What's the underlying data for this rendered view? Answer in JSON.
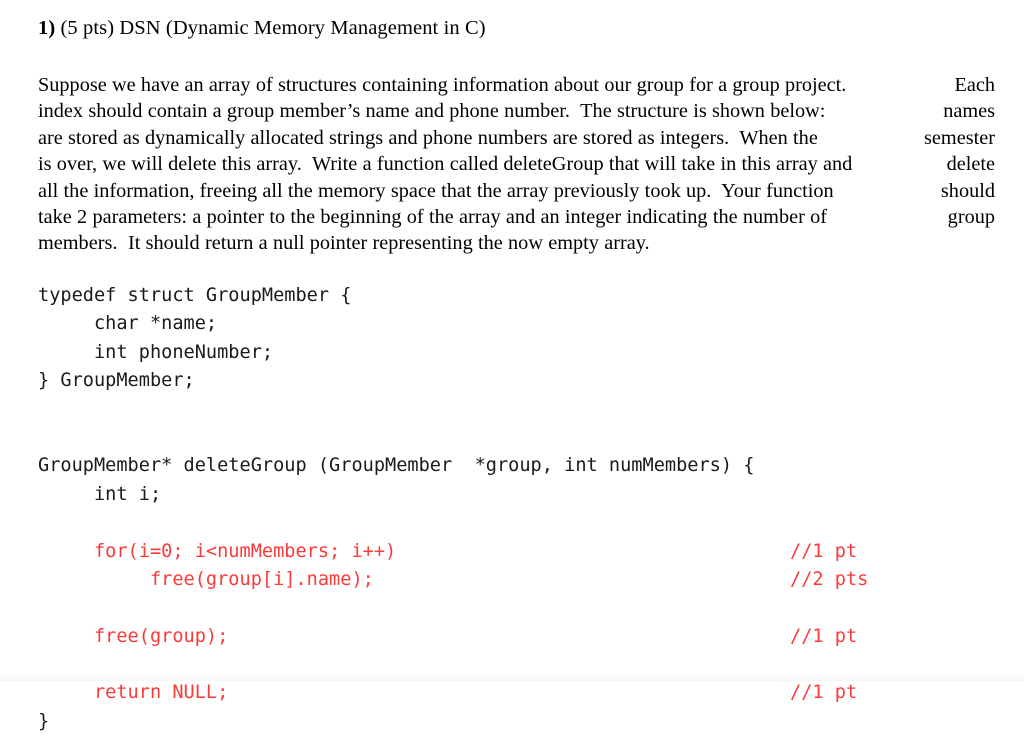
{
  "document": {
    "heading": {
      "number": "1)",
      "rest": " (5 pts) DSN (Dynamic Memory Management in C)"
    },
    "paragraph": {
      "lines": [
        {
          "left": "Suppose we have an array of structures containing information about our group for a group project.",
          "right": "Each"
        },
        {
          "left": "index should contain a group member’s name and phone number.  The structure is shown below:",
          "right": "names"
        },
        {
          "left": "are stored as dynamically allocated strings and phone numbers are stored as integers.  When the",
          "right": "semester"
        },
        {
          "left": "is over, we will delete this array.  Write a function called deleteGroup that will take in this array and",
          "right": "delete"
        },
        {
          "left": "all the information, freeing all the memory space that the array previously took up.  Your function",
          "right": "should"
        },
        {
          "left": "take 2 parameters: a pointer to the beginning of the array and an integer indicating the number of",
          "right": "group"
        },
        {
          "left": "members.  It should return a null pointer representing the now empty array.",
          "right": ""
        }
      ]
    },
    "code": {
      "colors": {
        "default": "#1a1a1a",
        "answer_red": "#fb3a3a"
      },
      "lines": [
        {
          "text": "typedef struct GroupMember {",
          "color": "black",
          "comment": ""
        },
        {
          "text": "     char *name;",
          "color": "black",
          "comment": ""
        },
        {
          "text": "     int phoneNumber;",
          "color": "black",
          "comment": ""
        },
        {
          "text": "} GroupMember;",
          "color": "black",
          "comment": ""
        },
        {
          "text": "",
          "color": "black",
          "comment": ""
        },
        {
          "text": "",
          "color": "black",
          "comment": ""
        },
        {
          "text": "GroupMember* deleteGroup (GroupMember  *group, int numMembers) {",
          "color": "black",
          "comment": ""
        },
        {
          "text": "     int i;",
          "color": "black",
          "comment": ""
        },
        {
          "text": "",
          "color": "black",
          "comment": ""
        },
        {
          "text": "     for(i=0; i<numMembers; i++)",
          "color": "red",
          "comment": "//1 pt"
        },
        {
          "text": "          free(group[i].name);",
          "color": "red",
          "comment": "//2 pts"
        },
        {
          "text": "",
          "color": "black",
          "comment": ""
        },
        {
          "text": "     free(group);",
          "color": "red",
          "comment": "//1 pt"
        },
        {
          "text": "",
          "color": "black",
          "comment": ""
        },
        {
          "text": "     return NULL;",
          "color": "red",
          "comment": "//1 pt"
        },
        {
          "text": "}",
          "color": "black",
          "comment": ""
        }
      ]
    }
  }
}
